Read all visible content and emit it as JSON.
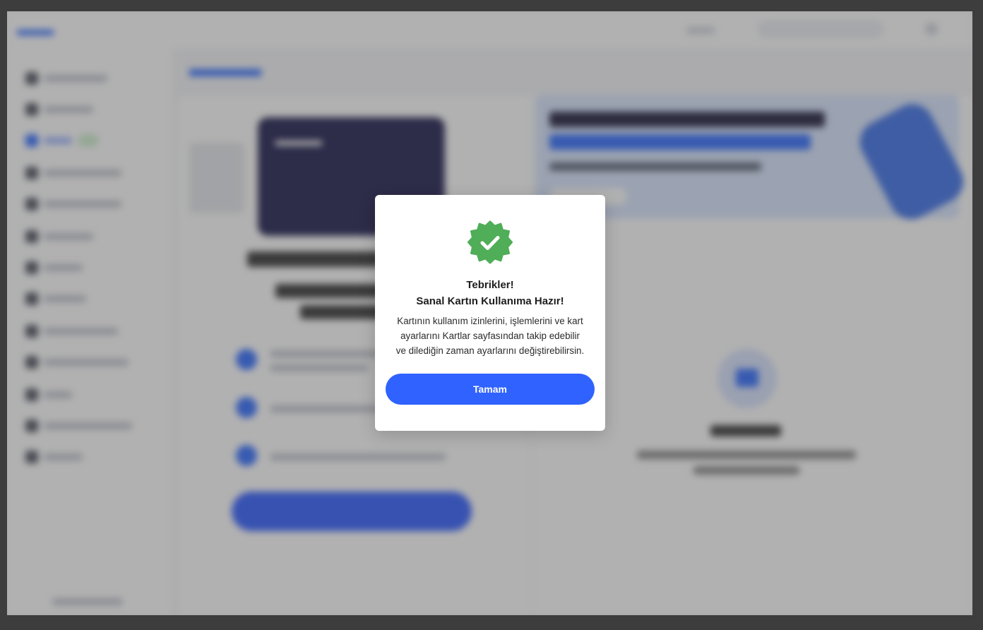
{
  "modal": {
    "icon": "verified-badge-check-icon",
    "title_line1": "Tebrikler!",
    "title_line2": "Sanal Kartın Kullanıma Hazır!",
    "body_line1": "Kartının kullanım izinlerini, işlemlerini ve kart",
    "body_line2": "ayarlarını Kartlar sayfasından takip edebilir",
    "body_line3": "ve dilediğin zaman ayarlarını değiştirebilirsin.",
    "ok_label": "Tamam"
  },
  "colors": {
    "accent": "#2f62ff",
    "success_badge": "#4fae57",
    "overlay": "#3d3d3d"
  }
}
